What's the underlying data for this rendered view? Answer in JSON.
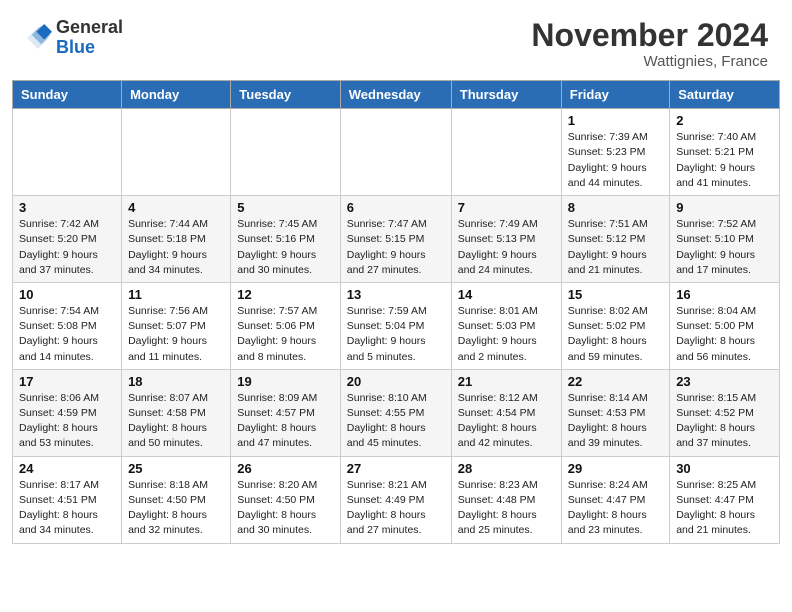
{
  "header": {
    "logo_general": "General",
    "logo_blue": "Blue",
    "month_title": "November 2024",
    "location": "Wattignies, France"
  },
  "days_of_week": [
    "Sunday",
    "Monday",
    "Tuesday",
    "Wednesday",
    "Thursday",
    "Friday",
    "Saturday"
  ],
  "weeks": [
    [
      {
        "day": "",
        "info": ""
      },
      {
        "day": "",
        "info": ""
      },
      {
        "day": "",
        "info": ""
      },
      {
        "day": "",
        "info": ""
      },
      {
        "day": "",
        "info": ""
      },
      {
        "day": "1",
        "info": "Sunrise: 7:39 AM\nSunset: 5:23 PM\nDaylight: 9 hours and 44 minutes."
      },
      {
        "day": "2",
        "info": "Sunrise: 7:40 AM\nSunset: 5:21 PM\nDaylight: 9 hours and 41 minutes."
      }
    ],
    [
      {
        "day": "3",
        "info": "Sunrise: 7:42 AM\nSunset: 5:20 PM\nDaylight: 9 hours and 37 minutes."
      },
      {
        "day": "4",
        "info": "Sunrise: 7:44 AM\nSunset: 5:18 PM\nDaylight: 9 hours and 34 minutes."
      },
      {
        "day": "5",
        "info": "Sunrise: 7:45 AM\nSunset: 5:16 PM\nDaylight: 9 hours and 30 minutes."
      },
      {
        "day": "6",
        "info": "Sunrise: 7:47 AM\nSunset: 5:15 PM\nDaylight: 9 hours and 27 minutes."
      },
      {
        "day": "7",
        "info": "Sunrise: 7:49 AM\nSunset: 5:13 PM\nDaylight: 9 hours and 24 minutes."
      },
      {
        "day": "8",
        "info": "Sunrise: 7:51 AM\nSunset: 5:12 PM\nDaylight: 9 hours and 21 minutes."
      },
      {
        "day": "9",
        "info": "Sunrise: 7:52 AM\nSunset: 5:10 PM\nDaylight: 9 hours and 17 minutes."
      }
    ],
    [
      {
        "day": "10",
        "info": "Sunrise: 7:54 AM\nSunset: 5:08 PM\nDaylight: 9 hours and 14 minutes."
      },
      {
        "day": "11",
        "info": "Sunrise: 7:56 AM\nSunset: 5:07 PM\nDaylight: 9 hours and 11 minutes."
      },
      {
        "day": "12",
        "info": "Sunrise: 7:57 AM\nSunset: 5:06 PM\nDaylight: 9 hours and 8 minutes."
      },
      {
        "day": "13",
        "info": "Sunrise: 7:59 AM\nSunset: 5:04 PM\nDaylight: 9 hours and 5 minutes."
      },
      {
        "day": "14",
        "info": "Sunrise: 8:01 AM\nSunset: 5:03 PM\nDaylight: 9 hours and 2 minutes."
      },
      {
        "day": "15",
        "info": "Sunrise: 8:02 AM\nSunset: 5:02 PM\nDaylight: 8 hours and 59 minutes."
      },
      {
        "day": "16",
        "info": "Sunrise: 8:04 AM\nSunset: 5:00 PM\nDaylight: 8 hours and 56 minutes."
      }
    ],
    [
      {
        "day": "17",
        "info": "Sunrise: 8:06 AM\nSunset: 4:59 PM\nDaylight: 8 hours and 53 minutes."
      },
      {
        "day": "18",
        "info": "Sunrise: 8:07 AM\nSunset: 4:58 PM\nDaylight: 8 hours and 50 minutes."
      },
      {
        "day": "19",
        "info": "Sunrise: 8:09 AM\nSunset: 4:57 PM\nDaylight: 8 hours and 47 minutes."
      },
      {
        "day": "20",
        "info": "Sunrise: 8:10 AM\nSunset: 4:55 PM\nDaylight: 8 hours and 45 minutes."
      },
      {
        "day": "21",
        "info": "Sunrise: 8:12 AM\nSunset: 4:54 PM\nDaylight: 8 hours and 42 minutes."
      },
      {
        "day": "22",
        "info": "Sunrise: 8:14 AM\nSunset: 4:53 PM\nDaylight: 8 hours and 39 minutes."
      },
      {
        "day": "23",
        "info": "Sunrise: 8:15 AM\nSunset: 4:52 PM\nDaylight: 8 hours and 37 minutes."
      }
    ],
    [
      {
        "day": "24",
        "info": "Sunrise: 8:17 AM\nSunset: 4:51 PM\nDaylight: 8 hours and 34 minutes."
      },
      {
        "day": "25",
        "info": "Sunrise: 8:18 AM\nSunset: 4:50 PM\nDaylight: 8 hours and 32 minutes."
      },
      {
        "day": "26",
        "info": "Sunrise: 8:20 AM\nSunset: 4:50 PM\nDaylight: 8 hours and 30 minutes."
      },
      {
        "day": "27",
        "info": "Sunrise: 8:21 AM\nSunset: 4:49 PM\nDaylight: 8 hours and 27 minutes."
      },
      {
        "day": "28",
        "info": "Sunrise: 8:23 AM\nSunset: 4:48 PM\nDaylight: 8 hours and 25 minutes."
      },
      {
        "day": "29",
        "info": "Sunrise: 8:24 AM\nSunset: 4:47 PM\nDaylight: 8 hours and 23 minutes."
      },
      {
        "day": "30",
        "info": "Sunrise: 8:25 AM\nSunset: 4:47 PM\nDaylight: 8 hours and 21 minutes."
      }
    ]
  ]
}
